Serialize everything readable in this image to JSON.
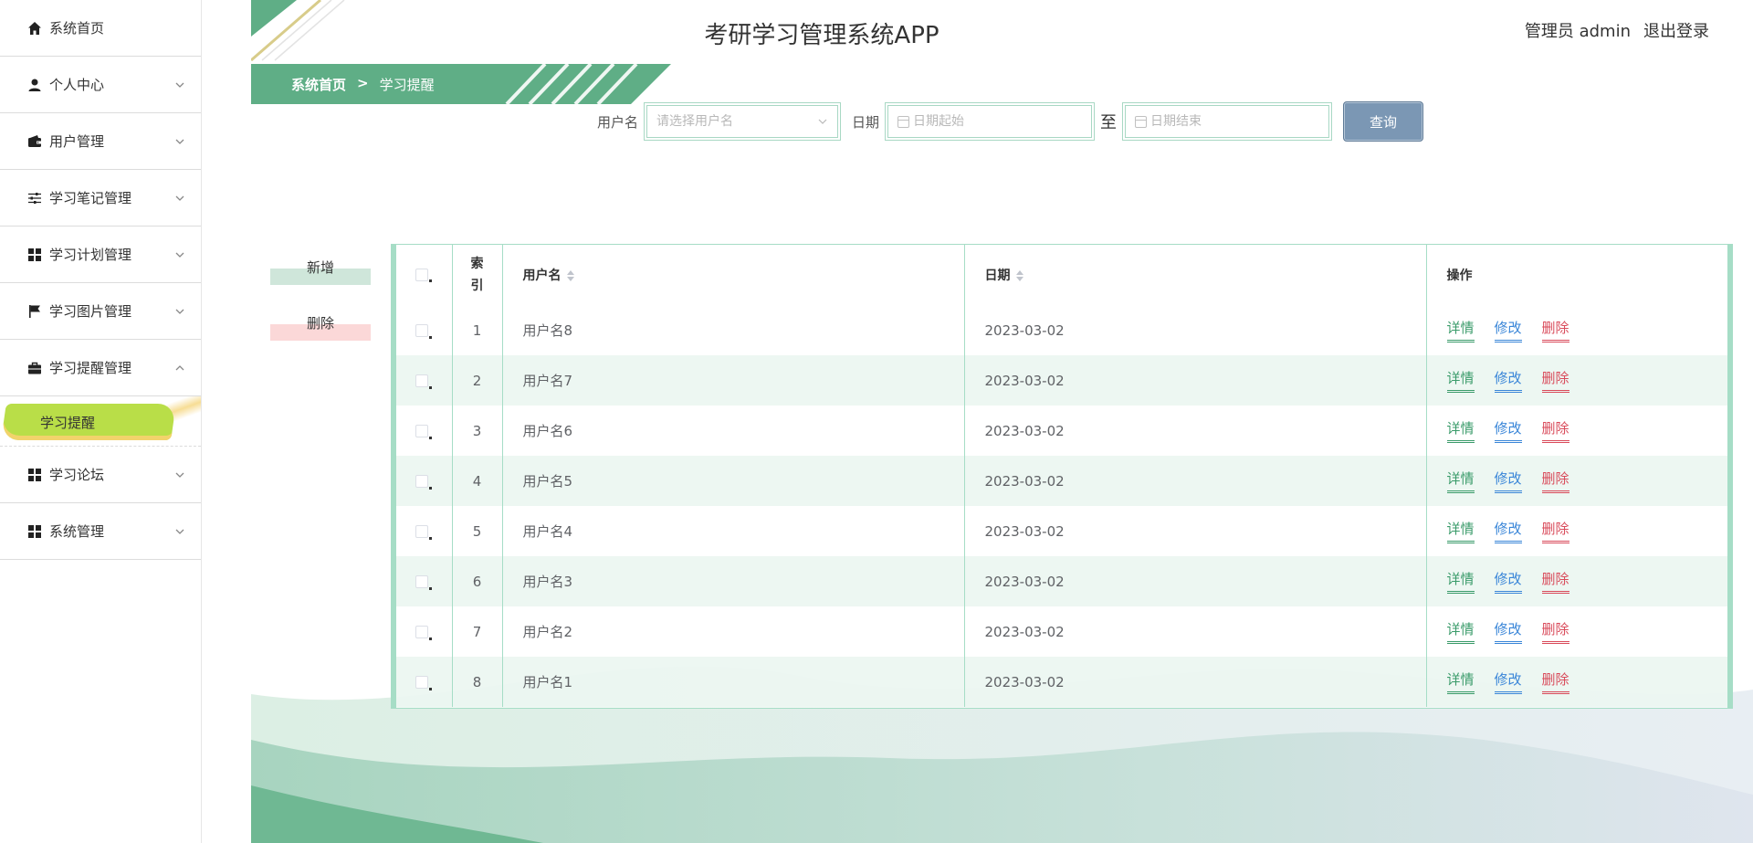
{
  "app": {
    "title": "考研学习管理系统APP"
  },
  "user": {
    "role_name": "管理员 admin",
    "logout": "退出登录"
  },
  "breadcrumb": {
    "home": "系统首页",
    "separator": ">",
    "current": "学习提醒"
  },
  "sidebar": {
    "items": [
      {
        "label": "系统首页",
        "icon": "home-icon",
        "expandable": false
      },
      {
        "label": "个人中心",
        "icon": "person-icon",
        "expandable": true
      },
      {
        "label": "用户管理",
        "icon": "wallet-icon",
        "expandable": true
      },
      {
        "label": "学习笔记管理",
        "icon": "sliders-icon",
        "expandable": true
      },
      {
        "label": "学习计划管理",
        "icon": "grid-icon",
        "expandable": true
      },
      {
        "label": "学习图片管理",
        "icon": "flag-icon",
        "expandable": true
      },
      {
        "label": "学习提醒管理",
        "icon": "briefcase-icon",
        "expandable": true,
        "expanded": true
      },
      {
        "label": "学习论坛",
        "icon": "grid-icon",
        "expandable": true
      },
      {
        "label": "系统管理",
        "icon": "grid-icon",
        "expandable": true
      }
    ],
    "active_sub": "学习提醒"
  },
  "search": {
    "username_label": "用户名",
    "username_placeholder": "请选择用户名",
    "date_label": "日期",
    "date_start_placeholder": "日期起始",
    "date_to": "至",
    "date_end_placeholder": "日期结束",
    "query_button": "查询"
  },
  "actions": {
    "add": "新增",
    "delete": "删除"
  },
  "table": {
    "headers": {
      "index": "索引",
      "username": "用户名",
      "date": "日期",
      "ops": "操作"
    },
    "op_labels": {
      "detail": "详情",
      "edit": "修改",
      "delete": "删除"
    },
    "rows": [
      {
        "index": "1",
        "username": "用户名8",
        "date": "2023-03-02"
      },
      {
        "index": "2",
        "username": "用户名7",
        "date": "2023-03-02"
      },
      {
        "index": "3",
        "username": "用户名6",
        "date": "2023-03-02"
      },
      {
        "index": "4",
        "username": "用户名5",
        "date": "2023-03-02"
      },
      {
        "index": "5",
        "username": "用户名4",
        "date": "2023-03-02"
      },
      {
        "index": "6",
        "username": "用户名3",
        "date": "2023-03-02"
      },
      {
        "index": "7",
        "username": "用户名2",
        "date": "2023-03-02"
      },
      {
        "index": "8",
        "username": "用户名1",
        "date": "2023-03-02"
      }
    ]
  },
  "colors": {
    "accent": "#5fae86",
    "active_sub": "#b9de48",
    "query": "#7b97b4",
    "detail": "#3a9b6a",
    "edit": "#3a86d8",
    "delete": "#d94a5a"
  }
}
